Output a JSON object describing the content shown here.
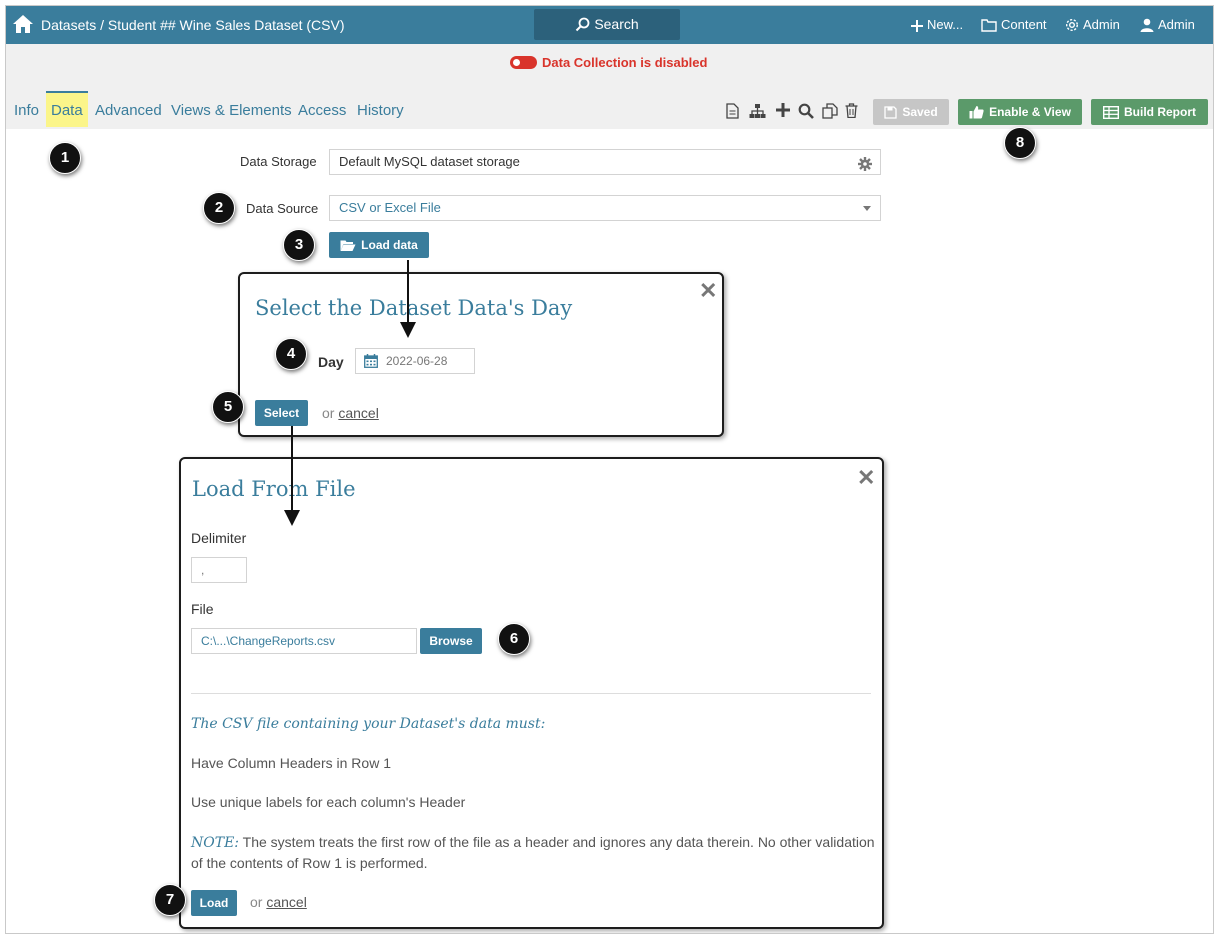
{
  "header": {
    "breadcrumb": "Datasets / Student ## Wine Sales Dataset (CSV)",
    "search_label": "Search",
    "new_label": "New...",
    "content_label": "Content",
    "admin_label": "Admin",
    "user_label": "Admin",
    "brand_color": "#3a7d9c"
  },
  "status": {
    "data_collection": "Data Collection is disabled",
    "color": "#d9342b"
  },
  "tabs": [
    {
      "label": "Info",
      "active": false
    },
    {
      "label": "Data",
      "active": true
    },
    {
      "label": "Advanced",
      "active": false
    },
    {
      "label": "Views & Elements",
      "active": false
    },
    {
      "label": "Access",
      "active": false
    },
    {
      "label": "History",
      "active": false
    }
  ],
  "toolbar": {
    "icons": [
      "document-icon",
      "hierarchy-icon",
      "plus-icon",
      "search-icon",
      "copy-icon",
      "trash-icon"
    ],
    "saved_label": "Saved",
    "enable_view_label": "Enable & View",
    "build_report_label": "Build Report"
  },
  "form": {
    "data_storage_label": "Data Storage",
    "data_storage_value": "Default MySQL dataset storage",
    "data_source_label": "Data Source",
    "data_source_value": "CSV or Excel File",
    "load_data_label": "Load data"
  },
  "day_dialog": {
    "title": "Select the Dataset Data's Day",
    "close": "✕",
    "day_label": "Day",
    "day_value": "2022-06-28",
    "select_label": "Select",
    "or": "or",
    "cancel": "cancel"
  },
  "file_dialog": {
    "title": "Load From File",
    "close": "✕",
    "delimiter_label": "Delimiter",
    "delimiter_value": ",",
    "file_label": "File",
    "file_value": "C:\\...\\ChangeReports.csv",
    "browse_label": "Browse",
    "requirements_title": "The CSV file containing your Dataset's data must:",
    "requirement_1": "Have Column Headers in Row 1",
    "requirement_2": "Use unique labels for each column's Header",
    "note_tag": "NOTE:",
    "note_text": " The system treats the first row of the file as a header and ignores any data therein. No other validation of the contents of Row 1 is performed.",
    "load_label": "Load",
    "or": "or",
    "cancel": "cancel"
  },
  "badges": [
    "1",
    "2",
    "3",
    "4",
    "5",
    "6",
    "7",
    "8"
  ]
}
